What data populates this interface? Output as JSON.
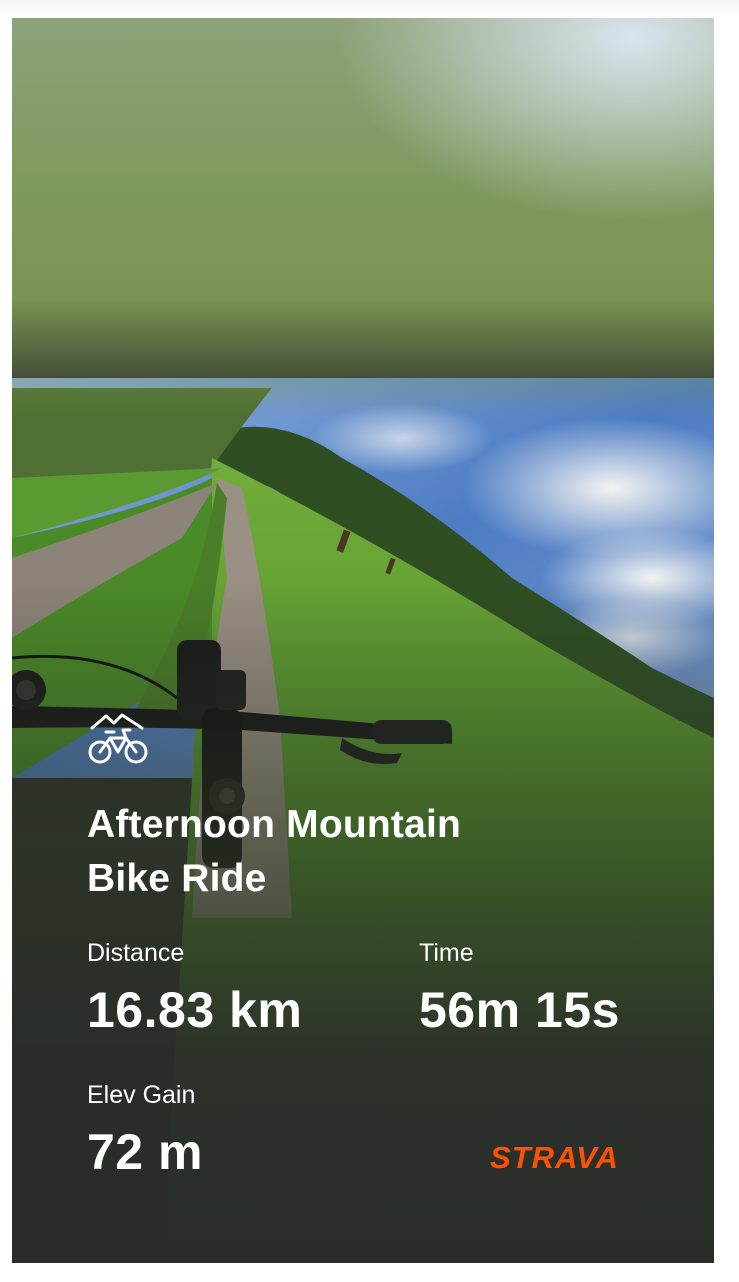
{
  "activity": {
    "sport_icon": "mountain-bike-icon",
    "title_line1": "Afternoon Mountain",
    "title_line2": "Bike Ride"
  },
  "stats": {
    "distance": {
      "label": "Distance",
      "value": "16.83 km"
    },
    "time": {
      "label": "Time",
      "value": "56m 15s"
    },
    "elev_gain": {
      "label": "Elev Gain",
      "value": "72 m"
    }
  },
  "brand": {
    "logo_text": "STRAVA",
    "color": "#fc5200"
  },
  "colors": {
    "text": "#ffffff",
    "card_dark": "#2a2c2a",
    "grass": "#4f8e2c",
    "sky": "#5a86c8"
  }
}
